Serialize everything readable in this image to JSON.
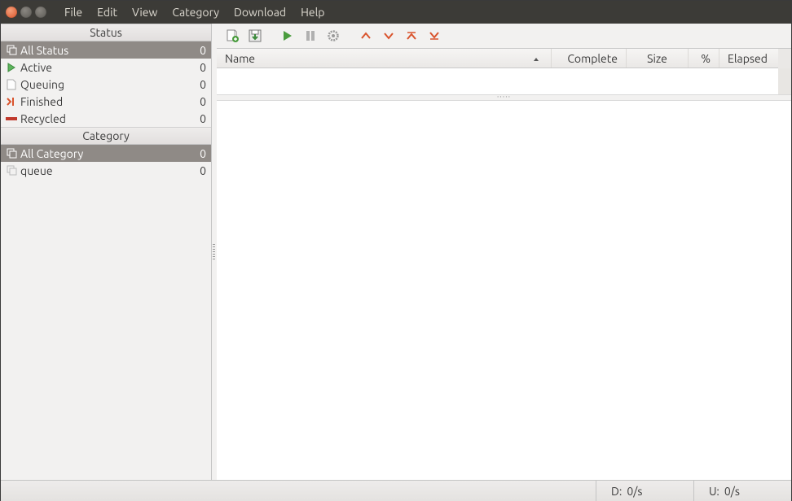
{
  "menu": [
    "File",
    "Edit",
    "View",
    "Category",
    "Download",
    "Help"
  ],
  "sidebar": {
    "status_header": "Status",
    "status_items": [
      {
        "label": "All Status",
        "count": "0",
        "icon": "stack",
        "selected": true
      },
      {
        "label": "Active",
        "count": "0",
        "icon": "play"
      },
      {
        "label": "Queuing",
        "count": "0",
        "icon": "file"
      },
      {
        "label": "Finished",
        "count": "0",
        "icon": "finish"
      },
      {
        "label": "Recycled",
        "count": "0",
        "icon": "recycle"
      }
    ],
    "category_header": "Category",
    "category_items": [
      {
        "label": "All Category",
        "count": "0",
        "icon": "stack",
        "selected": true
      },
      {
        "label": "queue",
        "count": "0",
        "icon": "stack-light"
      }
    ]
  },
  "columns": {
    "name": "Name",
    "complete": "Complete",
    "size": "Size",
    "pct": "%",
    "elapsed": "Elapsed"
  },
  "status": {
    "d_label": "D:",
    "d_val": "0/s",
    "u_label": "U:",
    "u_val": "0/s"
  }
}
